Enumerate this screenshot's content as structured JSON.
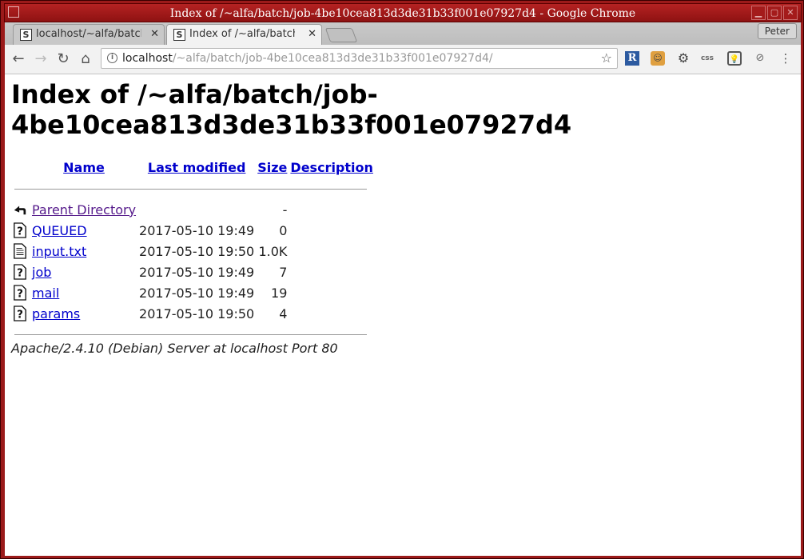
{
  "window": {
    "title": "Index of /~alfa/batch/job-4be10cea813d3de31b33f001e07927d4 - Google Chrome"
  },
  "tabs": [
    {
      "label": "localhost/~alfa/batch",
      "active": false
    },
    {
      "label": "Index of /~alfa/batch",
      "active": true
    }
  ],
  "profile": {
    "name": "Peter"
  },
  "toolbar": {
    "url_host": "localhost",
    "url_path": "/~alfa/batch/job-4be10cea813d3de31b33f001e07927d4/",
    "extensions": [
      "R",
      "css"
    ]
  },
  "page": {
    "heading": "Index of /~alfa/batch/job-4be10cea813d3de31b33f001e07927d4",
    "columns": {
      "name": "Name",
      "last_modified": "Last modified",
      "size": "Size",
      "description": "Description"
    },
    "rows": [
      {
        "icon": "back-icon",
        "name": "Parent Directory",
        "modified": "",
        "size": "-",
        "description": ""
      },
      {
        "icon": "unknown-file-icon",
        "name": "QUEUED",
        "modified": "2017-05-10 19:49",
        "size": "0",
        "description": ""
      },
      {
        "icon": "text-file-icon",
        "name": "input.txt",
        "modified": "2017-05-10 19:50",
        "size": "1.0K",
        "description": ""
      },
      {
        "icon": "unknown-file-icon",
        "name": "job",
        "modified": "2017-05-10 19:49",
        "size": "7",
        "description": ""
      },
      {
        "icon": "unknown-file-icon",
        "name": "mail",
        "modified": "2017-05-10 19:49",
        "size": "19",
        "description": ""
      },
      {
        "icon": "unknown-file-icon",
        "name": "params",
        "modified": "2017-05-10 19:50",
        "size": "4",
        "description": ""
      }
    ],
    "footer": "Apache/2.4.10 (Debian) Server at localhost Port 80"
  }
}
